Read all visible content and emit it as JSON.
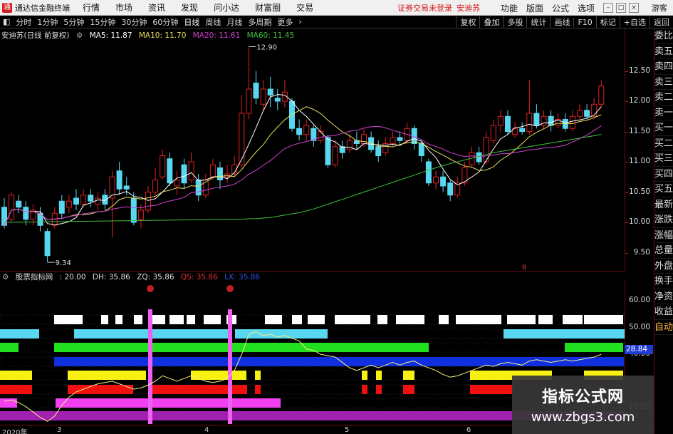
{
  "window": {
    "app_title": "通达信金融终端",
    "menu": [
      "行情",
      "市场",
      "资讯",
      "发现",
      "问小达",
      "财富圈",
      "交易"
    ],
    "trade_status": "证券交易未登录",
    "stock_name_top": "安迪苏",
    "right_buttons": [
      "功能",
      "版面",
      "公式",
      "选项"
    ],
    "guest": "游客"
  },
  "periodbar": {
    "periods": [
      "分时",
      "1分钟",
      "5分钟",
      "15分钟",
      "30分钟",
      "60分钟",
      "日线",
      "周线",
      "月线",
      "多周期",
      "更多"
    ],
    "active": "日线",
    "right_buttons": [
      "复权",
      "叠加",
      "多股",
      "统计",
      "画线",
      "F10",
      "标记",
      "+自选",
      "返回"
    ]
  },
  "legend": {
    "stock": "安迪苏(日线 前复权)",
    "ma": [
      {
        "label": "MA5: 11.87",
        "color": "#ffffff"
      },
      {
        "label": "MA10: 11.70",
        "color": "#e8e05a"
      },
      {
        "label": "MA20: 11.61",
        "color": "#d040d0"
      },
      {
        "label": "MA60: 11.45",
        "color": "#40c040"
      }
    ]
  },
  "price_axis": {
    "labels": [
      "12.50",
      "12.00",
      "11.50",
      "11.00",
      "10.50",
      "10.00",
      "9.50"
    ],
    "values": [
      12.5,
      12.0,
      11.5,
      11.0,
      10.5,
      10.0,
      9.5
    ],
    "high_mark": "12.90",
    "low_mark": "9.34"
  },
  "chart_data": [
    {
      "type": "candlestick",
      "title": "安迪苏(日线 前复权)",
      "ylim": [
        9.2,
        13.2
      ],
      "candles": [
        {
          "o": 10.25,
          "c": 9.95,
          "h": 10.4,
          "l": 9.9
        },
        {
          "o": 10.05,
          "c": 10.45,
          "h": 10.5,
          "l": 10.0
        },
        {
          "o": 10.35,
          "c": 10.25,
          "h": 10.45,
          "l": 10.15
        },
        {
          "o": 10.25,
          "c": 10.05,
          "h": 10.35,
          "l": 9.95
        },
        {
          "o": 10.05,
          "c": 10.2,
          "h": 10.3,
          "l": 9.95
        },
        {
          "o": 10.15,
          "c": 9.95,
          "h": 10.25,
          "l": 9.85
        },
        {
          "o": 9.85,
          "c": 9.45,
          "h": 9.9,
          "l": 9.34
        },
        {
          "o": 9.95,
          "c": 10.15,
          "h": 10.25,
          "l": 9.9
        },
        {
          "o": 10.35,
          "c": 10.15,
          "h": 10.45,
          "l": 10.05
        },
        {
          "o": 10.25,
          "c": 10.35,
          "h": 10.45,
          "l": 10.15
        },
        {
          "o": 10.4,
          "c": 10.3,
          "h": 10.55,
          "l": 10.2
        },
        {
          "o": 10.3,
          "c": 10.45,
          "h": 10.55,
          "l": 10.25
        },
        {
          "o": 10.45,
          "c": 10.35,
          "h": 10.55,
          "l": 10.25
        },
        {
          "o": 10.3,
          "c": 10.4,
          "h": 10.5,
          "l": 10.2
        },
        {
          "o": 10.45,
          "c": 10.3,
          "h": 10.55,
          "l": 10.2
        },
        {
          "o": 10.4,
          "c": 10.75,
          "h": 10.85,
          "l": 9.75
        },
        {
          "o": 10.85,
          "c": 10.55,
          "h": 11.0,
          "l": 10.45
        },
        {
          "o": 10.6,
          "c": 10.55,
          "h": 10.75,
          "l": 10.45
        },
        {
          "o": 10.4,
          "c": 10.0,
          "h": 10.5,
          "l": 9.95
        },
        {
          "o": 10.05,
          "c": 10.2,
          "h": 10.3,
          "l": 9.9
        },
        {
          "o": 10.2,
          "c": 10.5,
          "h": 10.6,
          "l": 10.15
        },
        {
          "o": 10.5,
          "c": 10.7,
          "h": 10.9,
          "l": 10.45
        },
        {
          "o": 10.75,
          "c": 11.1,
          "h": 11.2,
          "l": 10.7
        },
        {
          "o": 11.05,
          "c": 10.65,
          "h": 11.15,
          "l": 10.6
        },
        {
          "o": 10.6,
          "c": 10.7,
          "h": 10.85,
          "l": 10.45
        },
        {
          "o": 10.95,
          "c": 10.65,
          "h": 11.05,
          "l": 10.55
        },
        {
          "o": 10.7,
          "c": 11.0,
          "h": 11.15,
          "l": 10.65
        },
        {
          "o": 10.7,
          "c": 10.45,
          "h": 10.8,
          "l": 10.35
        },
        {
          "o": 10.45,
          "c": 10.7,
          "h": 10.8,
          "l": 10.4
        },
        {
          "o": 10.75,
          "c": 10.95,
          "h": 11.05,
          "l": 10.7
        },
        {
          "o": 10.9,
          "c": 10.7,
          "h": 11.0,
          "l": 10.55
        },
        {
          "o": 10.75,
          "c": 10.8,
          "h": 10.95,
          "l": 10.65
        },
        {
          "o": 10.8,
          "c": 10.95,
          "h": 11.1,
          "l": 10.75
        },
        {
          "o": 10.95,
          "c": 11.8,
          "h": 12.1,
          "l": 10.9
        },
        {
          "o": 11.8,
          "c": 12.2,
          "h": 12.9,
          "l": 11.7
        },
        {
          "o": 12.3,
          "c": 12.05,
          "h": 12.5,
          "l": 11.95
        },
        {
          "o": 11.95,
          "c": 12.2,
          "h": 12.35,
          "l": 11.85
        },
        {
          "o": 12.2,
          "c": 12.1,
          "h": 12.4,
          "l": 11.9
        },
        {
          "o": 12.05,
          "c": 12.0,
          "h": 12.2,
          "l": 11.85
        },
        {
          "o": 12.0,
          "c": 12.15,
          "h": 12.35,
          "l": 11.9
        },
        {
          "o": 12.0,
          "c": 11.55,
          "h": 12.05,
          "l": 11.5
        },
        {
          "o": 11.55,
          "c": 11.45,
          "h": 11.7,
          "l": 11.35
        },
        {
          "o": 11.45,
          "c": 11.6,
          "h": 11.7,
          "l": 11.35
        },
        {
          "o": 11.55,
          "c": 11.35,
          "h": 11.6,
          "l": 11.25
        },
        {
          "o": 11.35,
          "c": 11.5,
          "h": 11.6,
          "l": 11.3
        },
        {
          "o": 11.4,
          "c": 10.95,
          "h": 11.45,
          "l": 10.9
        },
        {
          "o": 10.95,
          "c": 11.25,
          "h": 11.35,
          "l": 10.9
        },
        {
          "o": 11.25,
          "c": 11.15,
          "h": 11.35,
          "l": 11.05
        },
        {
          "o": 11.2,
          "c": 11.35,
          "h": 11.45,
          "l": 11.15
        },
        {
          "o": 11.35,
          "c": 11.3,
          "h": 11.5,
          "l": 11.2
        },
        {
          "o": 11.3,
          "c": 11.45,
          "h": 11.55,
          "l": 11.25
        },
        {
          "o": 11.4,
          "c": 11.2,
          "h": 11.5,
          "l": 11.15
        },
        {
          "o": 11.25,
          "c": 11.1,
          "h": 11.35,
          "l": 11.0
        },
        {
          "o": 11.15,
          "c": 11.3,
          "h": 11.4,
          "l": 11.1
        },
        {
          "o": 11.3,
          "c": 11.4,
          "h": 11.5,
          "l": 11.25
        },
        {
          "o": 11.4,
          "c": 11.35,
          "h": 11.5,
          "l": 11.3
        },
        {
          "o": 11.35,
          "c": 11.55,
          "h": 11.65,
          "l": 11.3
        },
        {
          "o": 11.55,
          "c": 11.3,
          "h": 11.6,
          "l": 11.2
        },
        {
          "o": 11.3,
          "c": 11.1,
          "h": 11.35,
          "l": 11.0
        },
        {
          "o": 11.0,
          "c": 10.65,
          "h": 11.05,
          "l": 10.6
        },
        {
          "o": 10.65,
          "c": 10.75,
          "h": 10.85,
          "l": 10.55
        },
        {
          "o": 10.75,
          "c": 10.6,
          "h": 10.85,
          "l": 10.5
        },
        {
          "o": 10.65,
          "c": 10.45,
          "h": 10.7,
          "l": 10.35
        },
        {
          "o": 10.45,
          "c": 10.65,
          "h": 10.75,
          "l": 10.4
        },
        {
          "o": 10.65,
          "c": 10.9,
          "h": 11.0,
          "l": 10.6
        },
        {
          "o": 10.95,
          "c": 11.15,
          "h": 11.25,
          "l": 10.9
        },
        {
          "o": 11.15,
          "c": 11.0,
          "h": 11.25,
          "l": 10.95
        },
        {
          "o": 11.0,
          "c": 11.4,
          "h": 11.5,
          "l": 10.95
        },
        {
          "o": 11.35,
          "c": 11.6,
          "h": 11.7,
          "l": 11.3
        },
        {
          "o": 11.6,
          "c": 11.75,
          "h": 11.85,
          "l": 11.5
        },
        {
          "o": 11.75,
          "c": 11.5,
          "h": 11.85,
          "l": 11.45
        },
        {
          "o": 11.45,
          "c": 11.55,
          "h": 11.65,
          "l": 11.4
        },
        {
          "o": 11.55,
          "c": 11.5,
          "h": 11.65,
          "l": 11.45
        },
        {
          "o": 11.5,
          "c": 11.8,
          "h": 12.35,
          "l": 11.45
        },
        {
          "o": 11.8,
          "c": 11.6,
          "h": 11.95,
          "l": 11.55
        },
        {
          "o": 11.6,
          "c": 11.75,
          "h": 11.85,
          "l": 11.55
        },
        {
          "o": 11.75,
          "c": 11.6,
          "h": 11.85,
          "l": 11.5
        },
        {
          "o": 11.6,
          "c": 11.7,
          "h": 11.8,
          "l": 11.55
        },
        {
          "o": 11.7,
          "c": 11.55,
          "h": 11.8,
          "l": 11.5
        },
        {
          "o": 11.55,
          "c": 11.75,
          "h": 11.85,
          "l": 11.5
        },
        {
          "o": 11.75,
          "c": 11.85,
          "h": 11.95,
          "l": 11.7
        },
        {
          "o": 11.85,
          "c": 11.75,
          "h": 11.95,
          "l": 11.7
        },
        {
          "o": 11.75,
          "c": 11.95,
          "h": 12.05,
          "l": 11.7
        },
        {
          "o": 11.95,
          "c": 12.25,
          "h": 12.35,
          "l": 11.9
        }
      ],
      "ma_series": [
        {
          "name": "MA5",
          "color": "#ffffff"
        },
        {
          "name": "MA10",
          "color": "#e8e05a"
        },
        {
          "name": "MA20",
          "color": "#d040d0"
        },
        {
          "name": "MA60",
          "color": "#40c040"
        }
      ],
      "ma60": [
        10.05,
        10.05,
        10.06,
        10.06,
        10.07,
        10.08,
        10.1,
        10.12,
        10.14,
        10.16,
        10.19,
        10.22,
        10.26,
        10.3,
        10.34,
        10.38,
        10.42,
        10.46,
        10.5,
        10.54,
        10.58,
        10.62,
        10.66,
        10.7,
        10.74,
        10.78,
        10.82,
        10.86,
        10.9,
        10.94,
        10.97,
        11.0,
        11.03,
        11.06,
        11.09,
        11.12,
        11.15,
        11.17,
        11.19,
        11.21,
        11.23,
        11.25,
        11.27,
        11.29,
        11.31,
        11.33,
        11.35,
        11.37,
        11.39,
        11.41,
        11.43,
        11.45
      ]
    },
    {
      "type": "indicator",
      "title": "股票指标网",
      "ylim": [
        14,
        68
      ],
      "line_values": [
        22.5,
        23,
        22,
        20.5,
        18.5,
        16.5,
        15,
        17,
        21,
        24,
        26,
        27,
        28,
        29,
        29.5,
        30,
        29,
        28,
        27,
        27.5,
        28.5,
        30,
        32,
        31,
        30,
        31,
        32,
        31,
        30,
        29.5,
        30,
        31,
        34,
        40,
        47.5,
        48.5,
        47,
        47.5,
        46.5,
        47,
        46,
        45,
        42,
        41.5,
        40,
        39.5,
        39,
        37,
        35,
        34,
        35,
        36,
        35,
        36,
        37,
        36,
        37,
        37.5,
        36,
        35,
        34,
        32.5,
        31.5,
        32,
        33,
        34,
        35,
        36,
        35.5,
        36.5,
        37,
        36.5,
        36,
        37.5,
        38,
        37.5,
        37,
        37.5,
        38,
        37.5,
        38,
        38.5,
        39,
        40
      ]
    }
  ],
  "ind_header": {
    "name": "股票指标网",
    "values": [
      {
        "label": ": 20.00",
        "color": "#dddddd"
      },
      {
        "label": "DH: 35.86",
        "color": "#dddddd"
      },
      {
        "label": "ZQ: 35.86",
        "color": "#dddddd"
      },
      {
        "label": "QS: 35.86",
        "color": "#e03030"
      },
      {
        "label": "LX: 35.86",
        "color": "#3050e0"
      }
    ]
  },
  "ind_axis": {
    "labels": [
      "60.00",
      "50.00",
      "40.00",
      "20.00"
    ],
    "values": [
      60,
      50,
      40,
      20
    ],
    "current_value": "28.84"
  },
  "sidebar": {
    "items": [
      "委比",
      "卖五",
      "卖四",
      "卖三",
      "卖二",
      "卖一",
      "买一",
      "买二",
      "买三",
      "买四",
      "买五",
      "最新",
      "涨跌",
      "涨幅",
      "总量",
      "外盘",
      "换手",
      "净资",
      "收益",
      "自动"
    ]
  },
  "dates": [
    "2020年",
    "3",
    "4",
    "5",
    "6"
  ],
  "marker": "B",
  "watermark": {
    "title": "指标公式网",
    "url": "www.zbgs3.com"
  },
  "colors": {
    "up": "#e02020",
    "down": "#58d8f0",
    "axis": "#6a1010"
  }
}
